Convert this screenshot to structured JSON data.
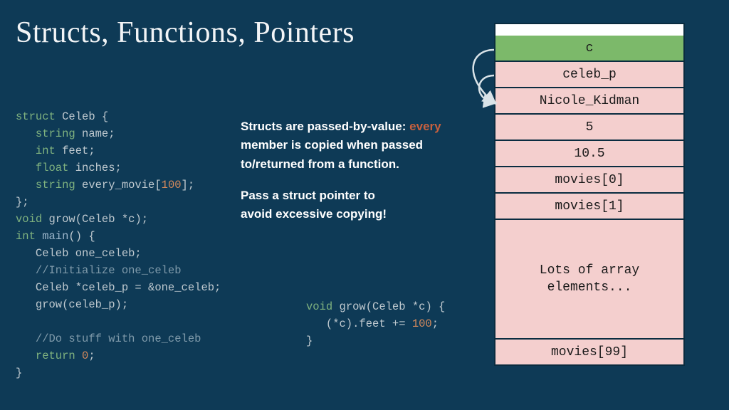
{
  "title": "Structs, Functions, Pointers",
  "note": {
    "l1a": "Structs are passed-by-value: ",
    "l1b": "every",
    "l2": "member is copied when passed",
    "l3": "to/returned from a function.",
    "l4": "Pass a struct pointer to",
    "l5": "avoid excessive copying!"
  },
  "code_left": {
    "l01_kw": "struct",
    "l01_rest": " Celeb {",
    "l02_kw": "string",
    "l02_rest": " name;",
    "l03_kw": "int",
    "l03_rest": " feet;",
    "l04_kw": "float",
    "l04_rest": " inches;",
    "l05_kw": "string",
    "l05_id": " every_movie[",
    "l05_num": "100",
    "l05_end": "];",
    "l06": "};",
    "l07_kw": "void",
    "l07_rest": " grow(Celeb *c);",
    "l08_kw": "int",
    "l08_fn": " main",
    "l08_rest": "() {",
    "l09": "   Celeb one_celeb;",
    "l10": "   //Initialize one_celeb",
    "l11": "   Celeb *celeb_p = &one_celeb;",
    "l12": "   grow(celeb_p);",
    "l13": "",
    "l14": "   //Do stuff with one_celeb",
    "l15_kw": "return",
    "l15_num": "0",
    "l15_end": ";",
    "l16": "}"
  },
  "code_right": {
    "l1_kw": "void",
    "l1_rest": " grow(Celeb *c) {",
    "l2a": "   (*c).feet += ",
    "l2_num": "100",
    "l2b": ";",
    "l3": "}"
  },
  "mem": {
    "c0": "c",
    "c1": "celeb_p",
    "c2": "Nicole_Kidman",
    "c3": "5",
    "c4": "10.5",
    "c5": "movies[0]",
    "c6": "movies[1]",
    "c7": "Lots of array\nelements...",
    "c8": "movies[99]"
  }
}
